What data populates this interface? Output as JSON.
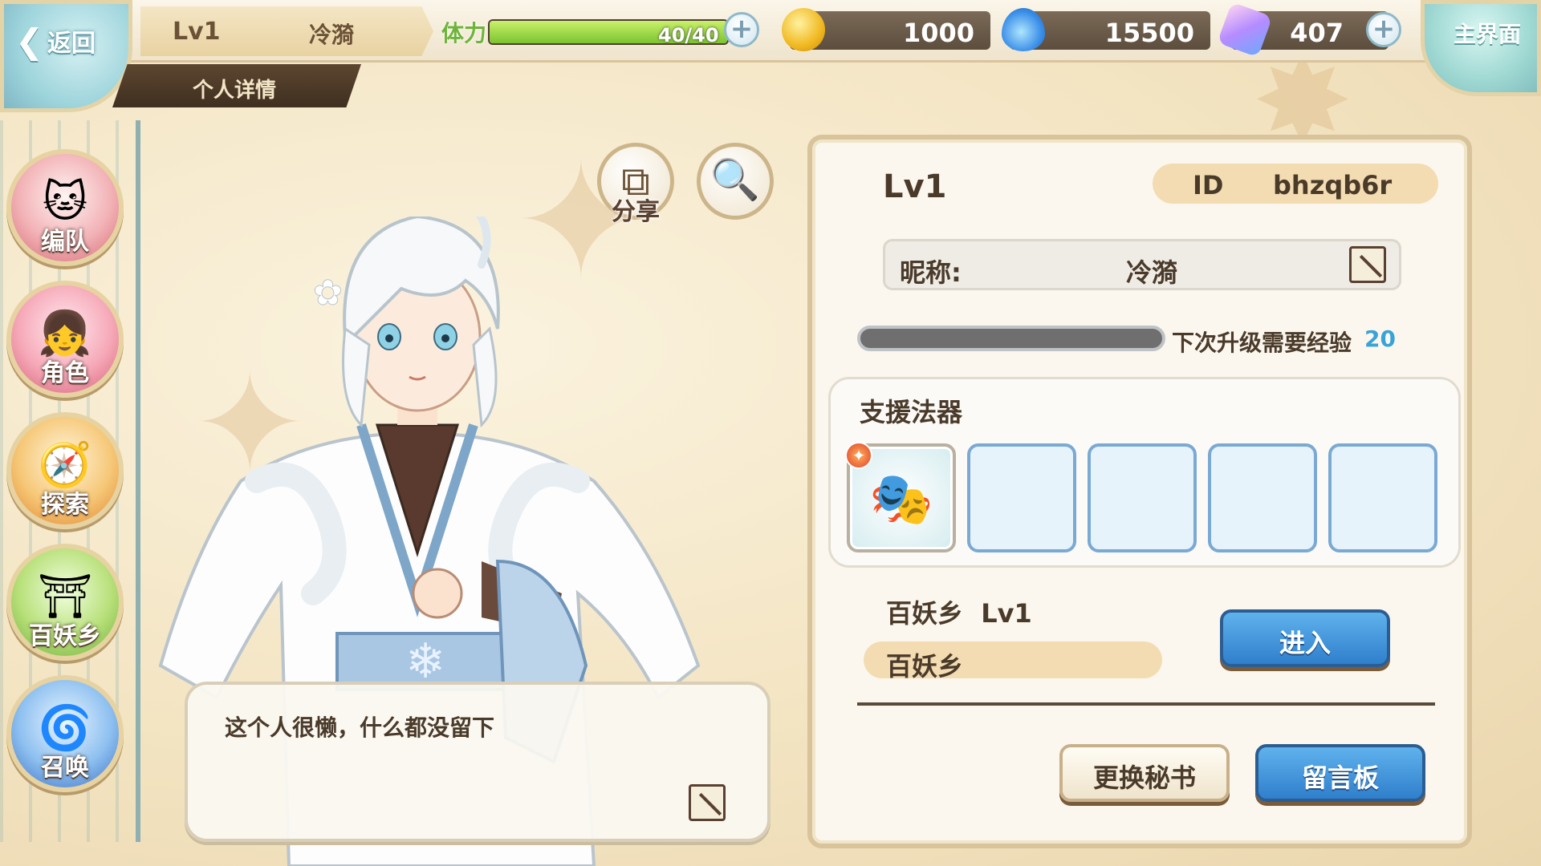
{
  "header": {
    "back_label": "返回",
    "player_level": "Lv1",
    "player_name": "冷漪",
    "section_title": "个人详情",
    "home_label": "主界面"
  },
  "resources": {
    "stamina_label": "体力",
    "stamina_text": "40/40",
    "stamina_fraction": 1.0,
    "gold": "1000",
    "soul_fire": "15500",
    "crystal": "407"
  },
  "nav": {
    "items": [
      {
        "label": "编队",
        "icon": "team-icon"
      },
      {
        "label": "角色",
        "icon": "character-icon"
      },
      {
        "label": "探索",
        "icon": "explore-icon"
      },
      {
        "label": "百妖乡",
        "icon": "village-icon"
      },
      {
        "label": "召唤",
        "icon": "summon-icon"
      }
    ]
  },
  "actions": {
    "share_label": "分享"
  },
  "bio": {
    "text": "这个人很懒，什么都没留下"
  },
  "profile": {
    "level": "Lv1",
    "id_label": "ID",
    "id_value": "bhzqb6r",
    "nickname_label": "昵称:",
    "nickname_value": "冷漪",
    "exp_label": "下次升级需要经验",
    "exp_value": "20",
    "exp_fraction": 0.0,
    "support_title": "支援法器",
    "village_title": "百妖乡  Lv1",
    "village_name": "百妖乡",
    "enter_label": "进入",
    "change_secretary_label": "更换秘书",
    "message_board_label": "留言板"
  },
  "colors": {
    "accent_blue": "#2f7fcc",
    "exp_value_color": "#38a3d8",
    "stamina_green": "#7cc430",
    "panel_border": "#d8c39a"
  }
}
